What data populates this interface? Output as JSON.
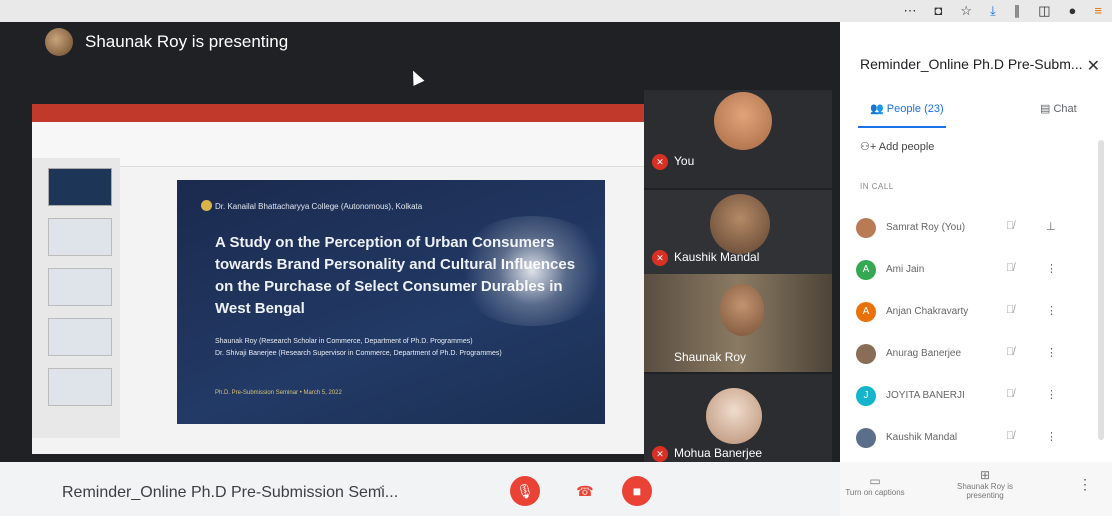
{
  "browser": {
    "icons": [
      "more-dots",
      "pocket",
      "star",
      "download",
      "library",
      "sidebar",
      "account",
      "menu"
    ]
  },
  "presenter": {
    "banner": "Shaunak Roy is presenting"
  },
  "slide": {
    "college": "Dr. Kanailal Bhattacharyya College (Autonomous), Kolkata",
    "title": "A Study on the Perception of Urban Consumers towards Brand Personality and Cultural Influences on the Purchase of Select Consumer Durables in West Bengal",
    "author1": "Shaunak Roy (Research Scholar in Commerce, Department of Ph.D. Programmes)",
    "author2": "Dr. Shivaji Banerjee (Research Supervisor in Commerce, Department of Ph.D. Programmes)",
    "footer": "Ph.D. Pre-Submission Seminar • March 5, 2022"
  },
  "tiles": [
    {
      "name": "You",
      "color": "#c98a5a"
    },
    {
      "name": "Kaushik Mandal",
      "color": "#8a6a4e"
    },
    {
      "name": "Shaunak Roy",
      "color": "#6a5a4a"
    },
    {
      "name": "Mohua Banerjee",
      "color": "#d8c4b0"
    }
  ],
  "bottom": {
    "meeting_title": "Reminder_Online Ph.D Pre-Submission Semi..."
  },
  "side": {
    "title": "Reminder_Online Ph.D Pre-Subm...",
    "close": "✕",
    "people_tab": "People (23)",
    "chat_tab": "Chat",
    "add_people": "Add people",
    "in_call": "IN CALL",
    "people": [
      {
        "name": "Samrat Roy (You)",
        "initial": "",
        "color": "#b97a56"
      },
      {
        "name": "Ami Jain",
        "initial": "A",
        "color": "#34a853"
      },
      {
        "name": "Anjan Chakravarty",
        "initial": "A",
        "color": "#e8710a"
      },
      {
        "name": "Anurag Banerjee",
        "initial": "",
        "color": "#8a6d56"
      },
      {
        "name": "JOYITA BANERJI",
        "initial": "J",
        "color": "#12b5cb"
      },
      {
        "name": "Kaushik Mandal",
        "initial": "",
        "color": "#5b6f8a"
      }
    ],
    "captions": "Turn on captions",
    "presenting": "Shaunak Roy is presenting"
  }
}
